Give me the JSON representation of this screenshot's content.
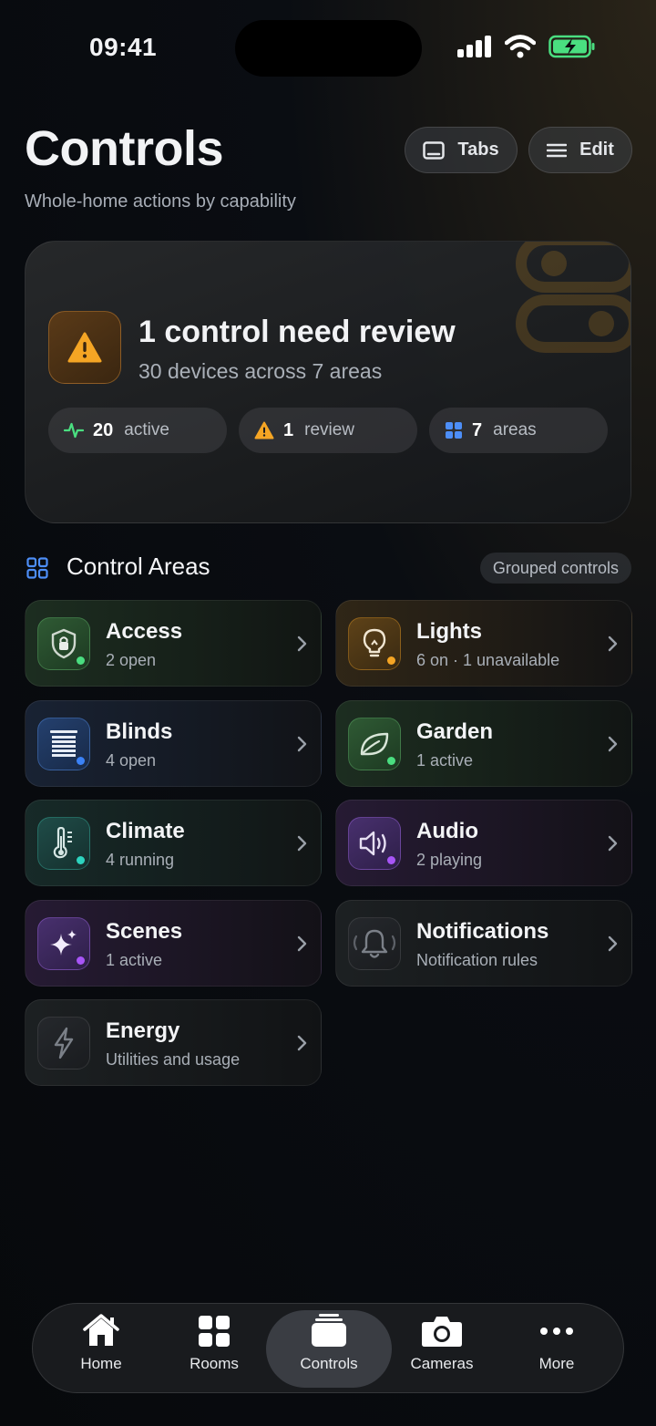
{
  "status_bar": {
    "time": "09:41"
  },
  "header": {
    "title": "Controls",
    "subtitle": "Whole-home actions by capability",
    "tabs_label": "Tabs",
    "edit_label": "Edit"
  },
  "summary": {
    "title": "1 control need review",
    "subtitle": "30 devices across 7 areas",
    "pills": [
      {
        "value": "20",
        "label": "active",
        "icon": "activity-icon",
        "color": "#4ade80"
      },
      {
        "value": "1",
        "label": "review",
        "icon": "warning-icon",
        "color": "#f5a524"
      },
      {
        "value": "7",
        "label": "areas",
        "icon": "grid-icon",
        "color": "#4d8ef7"
      }
    ]
  },
  "section": {
    "title": "Control Areas",
    "badge": "Grouped controls"
  },
  "areas": [
    {
      "name": "Access",
      "status": "2 open",
      "icon": "shield-lock-icon",
      "accent": "#4caf50"
    },
    {
      "name": "Lights",
      "status": "6 on · 1 unavailable",
      "icon": "lightbulb-icon",
      "accent": "#f5a524"
    },
    {
      "name": "Blinds",
      "status": "4 open",
      "icon": "blinds-icon",
      "accent": "#3b82f6"
    },
    {
      "name": "Garden",
      "status": "1 active",
      "icon": "leaf-icon",
      "accent": "#4ade80"
    },
    {
      "name": "Climate",
      "status": "4 running",
      "icon": "thermometer-icon",
      "accent": "#2dd4bf"
    },
    {
      "name": "Audio",
      "status": "2 playing",
      "icon": "speaker-icon",
      "accent": "#a855f7"
    },
    {
      "name": "Scenes",
      "status": "1 active",
      "icon": "sparkles-icon",
      "accent": "#a855f7"
    },
    {
      "name": "Notifications",
      "status": "Notification rules",
      "icon": "bell-icon",
      "accent": "#6b7280"
    },
    {
      "name": "Energy",
      "status": "Utilities and usage",
      "icon": "bolt-icon",
      "accent": "#6b7280"
    }
  ],
  "tabbar": [
    {
      "label": "Home",
      "icon": "house-icon"
    },
    {
      "label": "Rooms",
      "icon": "grid-icon"
    },
    {
      "label": "Controls",
      "icon": "controls-stack-icon",
      "active": true
    },
    {
      "label": "Cameras",
      "icon": "camera-icon"
    },
    {
      "label": "More",
      "icon": "ellipsis-icon"
    }
  ]
}
